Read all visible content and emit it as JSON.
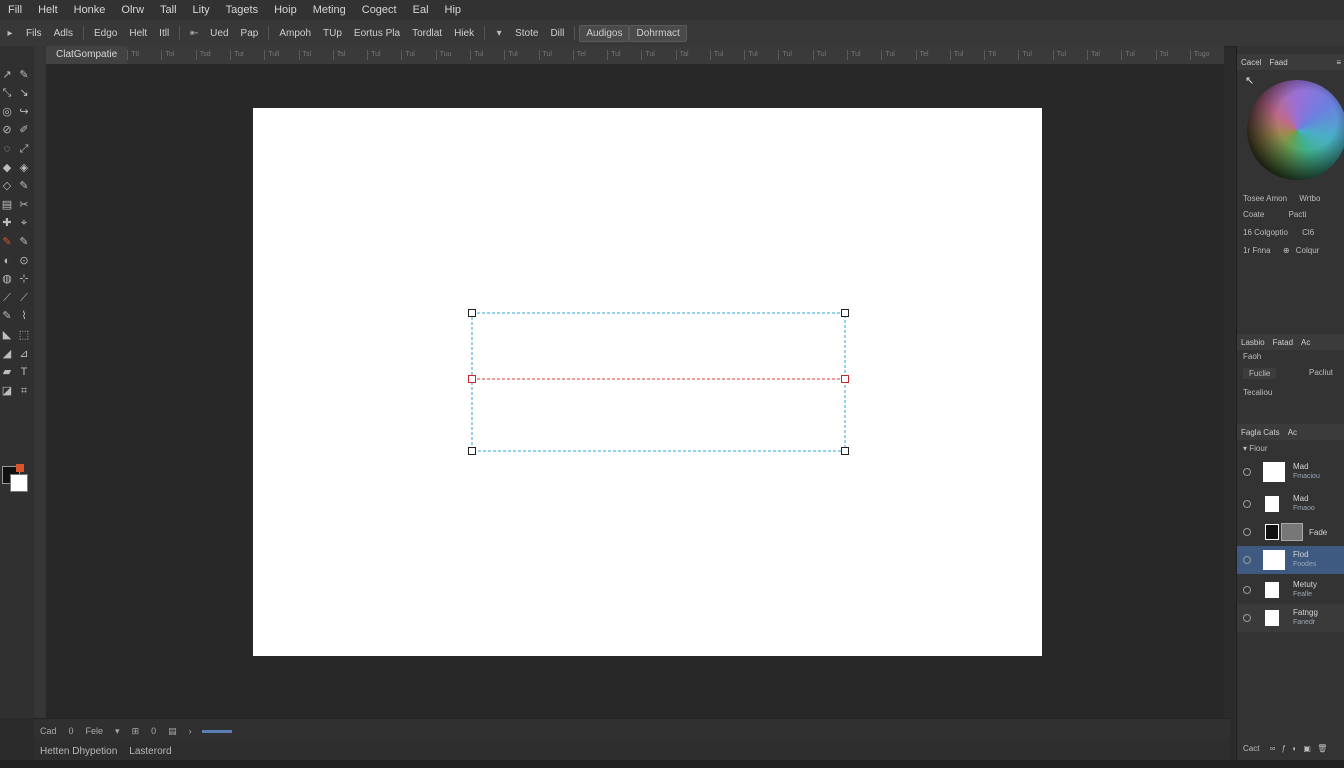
{
  "menu": [
    "Fill",
    "Helt",
    "Honke",
    "Olrw",
    "Tall",
    "Lity",
    "Tagets",
    "Hoip",
    "Meting",
    "Cogect",
    "Eal",
    "Hip"
  ],
  "options": {
    "items": [
      "Fils",
      "Adls",
      "Edgo",
      "Helt",
      "Itll"
    ],
    "group2": [
      "Ued",
      "Pap",
      "Ampoh",
      "TUp",
      "Eortus Pla",
      "Tordlat",
      "Hiek"
    ],
    "group3": [
      "Stote",
      "Dill"
    ],
    "pills": [
      "Audigos",
      "Dohrmact"
    ]
  },
  "tab": {
    "title": "ClatGompatie",
    "ruler_marks": [
      "Ttl",
      "Tol",
      "Tsd",
      "Tut",
      "Tull",
      "Tsl",
      "Tsl",
      "Tul",
      "Tul",
      "Tuu",
      "Tul",
      "Tul",
      "Tul",
      "Tel",
      "Tul",
      "Tul",
      "Tal",
      "Tul",
      "Tul",
      "Tul",
      "Tul",
      "Tul",
      "Tul",
      "Tel",
      "Tul",
      "Ttl",
      "Tul",
      "Tul",
      "Tal",
      "Tul",
      "Tsl",
      "Tugo"
    ]
  },
  "statusbar": [
    "Cad",
    "0",
    "Fele",
    "0"
  ],
  "infobar": [
    "Hetten Dhypetion",
    "Lasterord"
  ],
  "rightpanel": {
    "top_tabs": [
      "Cacel",
      "Faad"
    ],
    "color_labels": [
      {
        "left": "Tosee Amon",
        "right": "Wrtbo"
      },
      {
        "left": "Coate",
        "right": "Pacti"
      },
      {
        "left": "16 Colgoptio",
        "right": "Cl6"
      },
      {
        "left": "1r Fnna",
        "right": "Colqur"
      }
    ],
    "mid_tabs": [
      "Lasbio",
      "Fatad",
      "Ac"
    ],
    "mid_rows": [
      "Faoh",
      "Fuclie",
      "Pacliut",
      "Tecaliou"
    ],
    "layers_tabs": [
      "Fagla Cats",
      "Ac"
    ],
    "layers_header": "Fiour",
    "layers": [
      {
        "name": "Mad",
        "sub": "Fmaciou"
      },
      {
        "name": "Mad",
        "sub": "Fmaoo"
      },
      {
        "name": "Fade",
        "sub": ""
      },
      {
        "name": "Flod",
        "sub": "Foodes"
      },
      {
        "name": "Metuty",
        "sub": "Fealle"
      },
      {
        "name": "Fatngg",
        "sub": "Fanedr"
      }
    ],
    "footer": [
      "Cact"
    ]
  },
  "colors": {
    "selection_outline": "#2ea6d8",
    "midline": "#e23a3a",
    "layer_selected": "#3f5a80",
    "accent_tool": "#d9552c"
  }
}
